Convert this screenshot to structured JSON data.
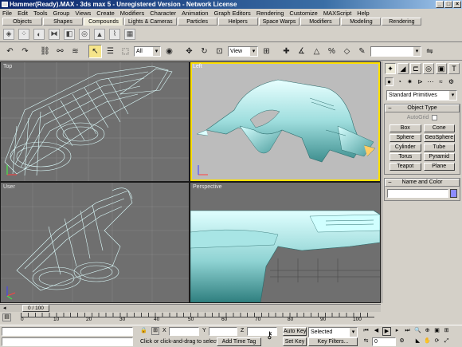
{
  "window": {
    "title": "Hammer(Ready).MAX - 3ds max 5 - Unregistered Version - Network License"
  },
  "menu": [
    "File",
    "Edit",
    "Tools",
    "Group",
    "Views",
    "Create",
    "Modifiers",
    "Character",
    "Animation",
    "Graph Editors",
    "Rendering",
    "Customize",
    "MAXScript",
    "Help"
  ],
  "tabs": [
    "Objects",
    "Shapes",
    "Compounds",
    "Lights & Cameras",
    "Particles",
    "Helpers",
    "Space Warps",
    "Modifiers",
    "Modeling",
    "Rendering"
  ],
  "active_tab": "Compounds",
  "toolbar": {
    "filter": "All",
    "refcoord": "View",
    "named_selection": ""
  },
  "viewports": [
    {
      "label": "Top"
    },
    {
      "label": "Left"
    },
    {
      "label": "User"
    },
    {
      "label": "Perspective"
    }
  ],
  "command_panel": {
    "category": "Standard Primitives",
    "object_type_title": "Object Type",
    "autogrid": "AutoGrid",
    "buttons": [
      "Box",
      "Cone",
      "Sphere",
      "GeoSphere",
      "Cylinder",
      "Tube",
      "Torus",
      "Pyramid",
      "Teapot",
      "Plane"
    ],
    "name_color_title": "Name and Color",
    "color": "#8c8cff"
  },
  "timeline": {
    "position": "0 / 100",
    "ticks": [
      "0",
      "10",
      "20",
      "30",
      "40",
      "50",
      "60",
      "70",
      "80",
      "90",
      "100"
    ]
  },
  "status": {
    "x_label": "X",
    "y_label": "Y",
    "z_label": "Z",
    "prompt": "Click or click-and-drag to select obj",
    "add_time_tag": "Add Time Tag",
    "auto_key": "Auto Key",
    "set_key": "Set Key",
    "selected": "Selected",
    "key_filters": "Key Filters...",
    "frame": "0"
  }
}
